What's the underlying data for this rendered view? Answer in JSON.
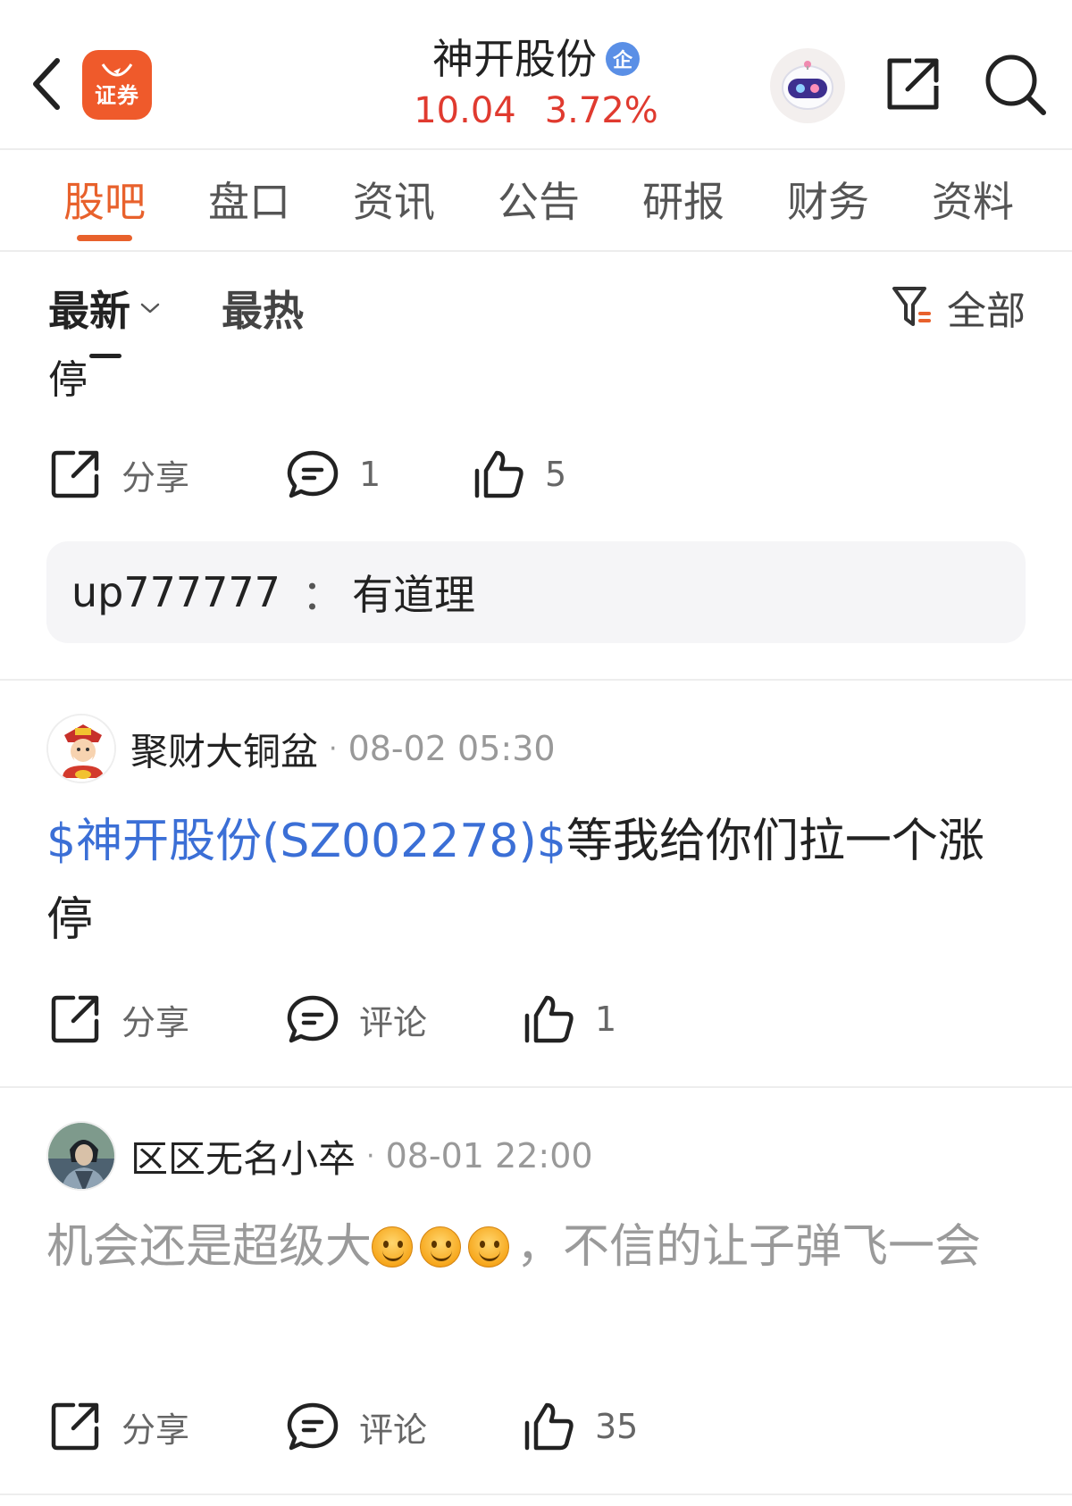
{
  "header": {
    "app_logo_text": "证券",
    "stock_name": "神开股份",
    "verified_badge": "企",
    "price": "10.04",
    "change_pct": "3.72%",
    "colors": {
      "up": "#e03a2f",
      "accent": "#e8612c",
      "link": "#3b6fd6"
    }
  },
  "tabs": [
    "股吧",
    "盘口",
    "资讯",
    "公告",
    "研报",
    "财务",
    "资料"
  ],
  "active_tab": "股吧",
  "filter": {
    "sort_latest": "最新",
    "sort_hot": "最热",
    "filter_all": "全部"
  },
  "posts": [
    {
      "body_cut": "停",
      "actions": {
        "share": "分享",
        "comment": "1",
        "like": "5"
      },
      "reply": {
        "user": "up777777",
        "sep": "：",
        "text": "有道理"
      }
    },
    {
      "author": "聚财大铜盆",
      "time": "08-02 05:30",
      "stock_link": "$神开股份(SZ002278)$",
      "body": "等我给你们拉一个涨停",
      "actions": {
        "share": "分享",
        "comment": "评论",
        "like": "1"
      }
    },
    {
      "author": "区区无名小卒",
      "time": "08-01 22:00",
      "body_before_emoji": "机会还是超级大",
      "emoji_count": 3,
      "body_after_emoji": "，不信的让子弹飞一会",
      "actions": {
        "share": "分享",
        "comment": "评论",
        "like": "35"
      }
    }
  ]
}
